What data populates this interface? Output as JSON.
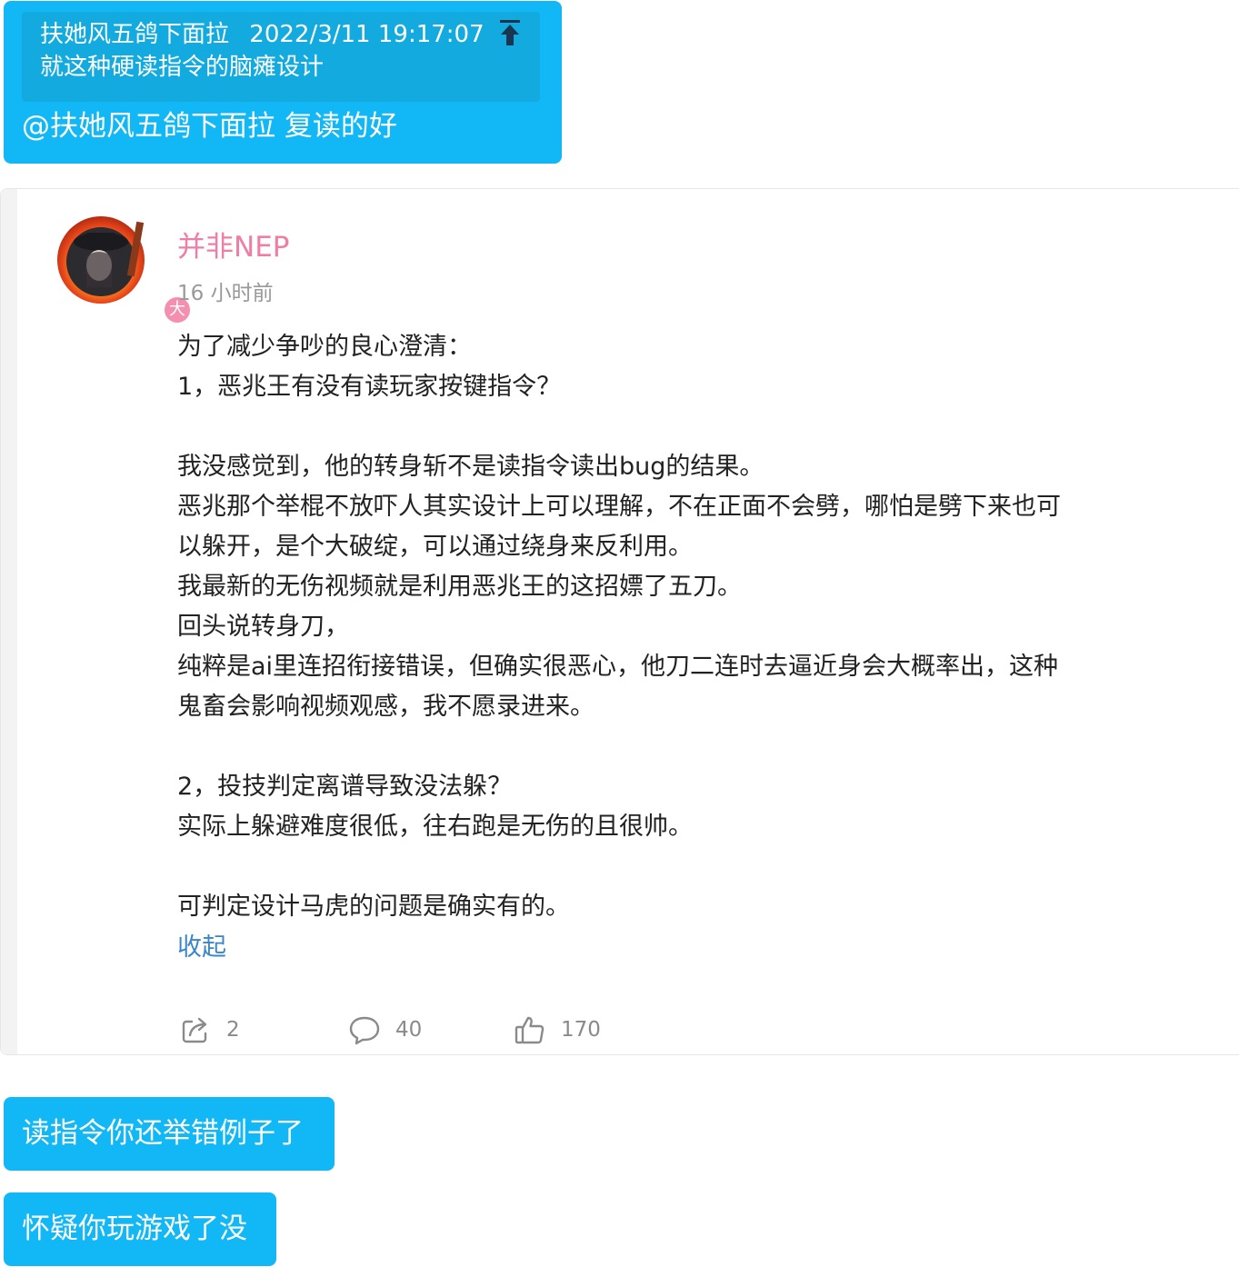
{
  "bubble_quote": {
    "quote_author": "扶她风五鸽下面拉",
    "quote_time": "2022/3/11 19:17:07",
    "quote_text": "就这种硬读指令的脑瘫设计",
    "reply": "@扶她风五鸽下面拉 复读的好"
  },
  "post": {
    "username": "并非NEP",
    "badge": "大",
    "timestamp": "16 小时前",
    "lines": [
      "为了减少争吵的良心澄清：",
      "1，恶兆王有没有读玩家按键指令？",
      "",
      "我没感觉到，他的转身斩不是读指令读出bug的结果。",
      "恶兆那个举棍不放吓人其实设计上可以理解，不在正面不会劈，哪怕是劈下来也可",
      "以躲开，是个大破绽，可以通过绕身来反利用。",
      "我最新的无伤视频就是利用恶兆王的这招嫖了五刀。",
      "回头说转身刀，",
      "纯粹是ai里连招衔接错误，但确实很恶心，他刀二连时去逼近身会大概率出，这种",
      "鬼畜会影响视频观感，我不愿录进来。",
      "",
      "2，投技判定离谱导致没法躲？",
      "实际上躲避难度很低，往右跑是无伤的且很帅。",
      "",
      "可判定设计马虎的问题是确实有的。"
    ],
    "collapse_label": "收起",
    "share_count": "2",
    "comment_count": "40",
    "like_count": "170"
  },
  "bubble_2": "读指令你还举错例子了",
  "bubble_3": "怀疑你玩游戏了没",
  "colors": {
    "bubble": "#12b7f5",
    "quote_box": "#13aadf",
    "username": "#f07da5",
    "link": "#3a86c8"
  }
}
